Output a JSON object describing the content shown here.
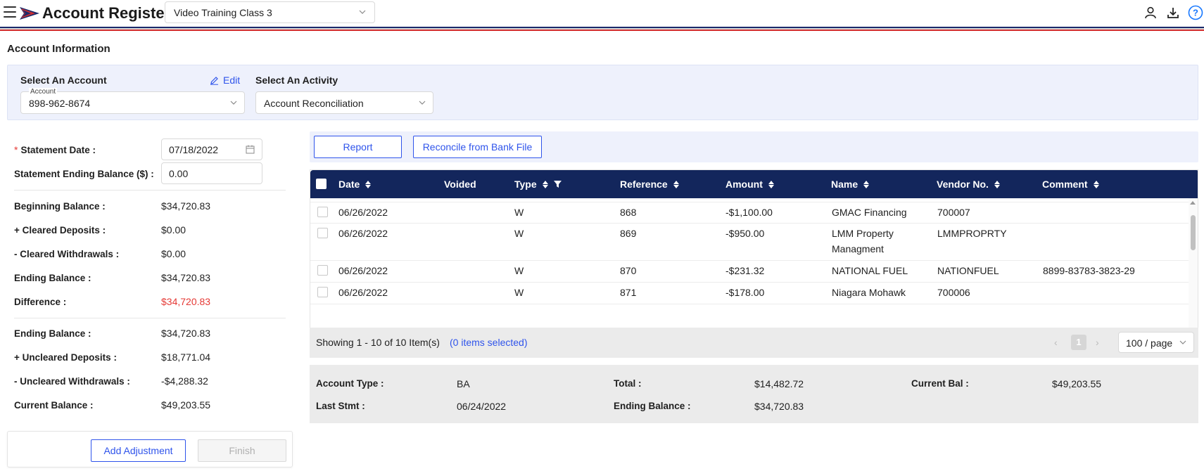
{
  "header": {
    "app_title": "Account Register",
    "company_select": "Video Training Class 3",
    "icons": [
      "menu-icon",
      "user-icon",
      "download-icon",
      "help-icon"
    ]
  },
  "section_title": "Account Information",
  "account_panel": {
    "select_account_label": "Select An Account",
    "edit_label": "Edit",
    "account_float_label": "Account",
    "account_value": "898-962-8674",
    "select_activity_label": "Select An Activity",
    "activity_value": "Account Reconciliation"
  },
  "statement": {
    "date_label": "Statement Date",
    "date_value": "07/18/2022",
    "ending_balance_label": "Statement Ending Balance ($)",
    "ending_balance_value": "0.00",
    "colon": ":"
  },
  "summary_left": [
    {
      "label": "Beginning Balance",
      "value": "$34,720.83"
    },
    {
      "label": "+ Cleared Deposits",
      "value": "$0.00"
    },
    {
      "label": "- Cleared Withdrawals",
      "value": "$0.00"
    },
    {
      "label": "Ending Balance",
      "value": "$34,720.83"
    },
    {
      "label": "Difference",
      "value": "$34,720.83"
    },
    {
      "label": "Ending Balance",
      "value": "$34,720.83"
    },
    {
      "label": "+ Uncleared Deposits",
      "value": "$18,771.04"
    },
    {
      "label": "- Uncleared Withdrawals",
      "value": "-$4,288.32"
    },
    {
      "label": "Current Balance",
      "value": "$49,203.55"
    }
  ],
  "buttons": {
    "add_adjustment": "Add Adjustment",
    "finish": "Finish",
    "report": "Report",
    "reconcile_bank_file": "Reconcile from Bank File"
  },
  "table": {
    "columns": [
      "Date",
      "Voided",
      "Type",
      "Reference",
      "Amount",
      "Name",
      "Vendor No.",
      "Comment"
    ],
    "rows": [
      {
        "date": "06/26/2022",
        "voided": "",
        "type": "W",
        "reference": "868",
        "amount": "-$1,100.00",
        "name": "GMAC Financing",
        "name2": "",
        "vendor": "700007",
        "comment": ""
      },
      {
        "date": "06/26/2022",
        "voided": "",
        "type": "W",
        "reference": "869",
        "amount": "-$950.00",
        "name": "LMM Property",
        "name2": "Managment",
        "vendor": "LMMPROPRTY",
        "comment": ""
      },
      {
        "date": "06/26/2022",
        "voided": "",
        "type": "W",
        "reference": "870",
        "amount": "-$231.32",
        "name": "NATIONAL FUEL",
        "name2": "",
        "vendor": "NATIONFUEL",
        "comment": "8899-83783-3823-29"
      },
      {
        "date": "06/26/2022",
        "voided": "",
        "type": "W",
        "reference": "871",
        "amount": "-$178.00",
        "name": "Niagara Mohawk",
        "name2": "",
        "vendor": "700006",
        "comment": ""
      }
    ]
  },
  "pager": {
    "showing": "Showing 1 - 10 of 10 Item(s)",
    "selected": "(0 items selected)",
    "page": "1",
    "page_size": "100 / page"
  },
  "account_summary": {
    "account_type_label": "Account Type",
    "account_type": "BA",
    "total_label": "Total",
    "total": "$14,482.72",
    "current_bal_label": "Current Bal",
    "current_bal": "$49,203.55",
    "last_stmt_label": "Last Stmt",
    "last_stmt": "06/24/2022",
    "ending_balance_label": "Ending Balance",
    "ending_balance": "$34,720.83"
  },
  "colors": {
    "accent": "#2f54eb",
    "header_bg": "#13265c",
    "panel_bg": "#eef1fc",
    "negative": "#e53935"
  }
}
